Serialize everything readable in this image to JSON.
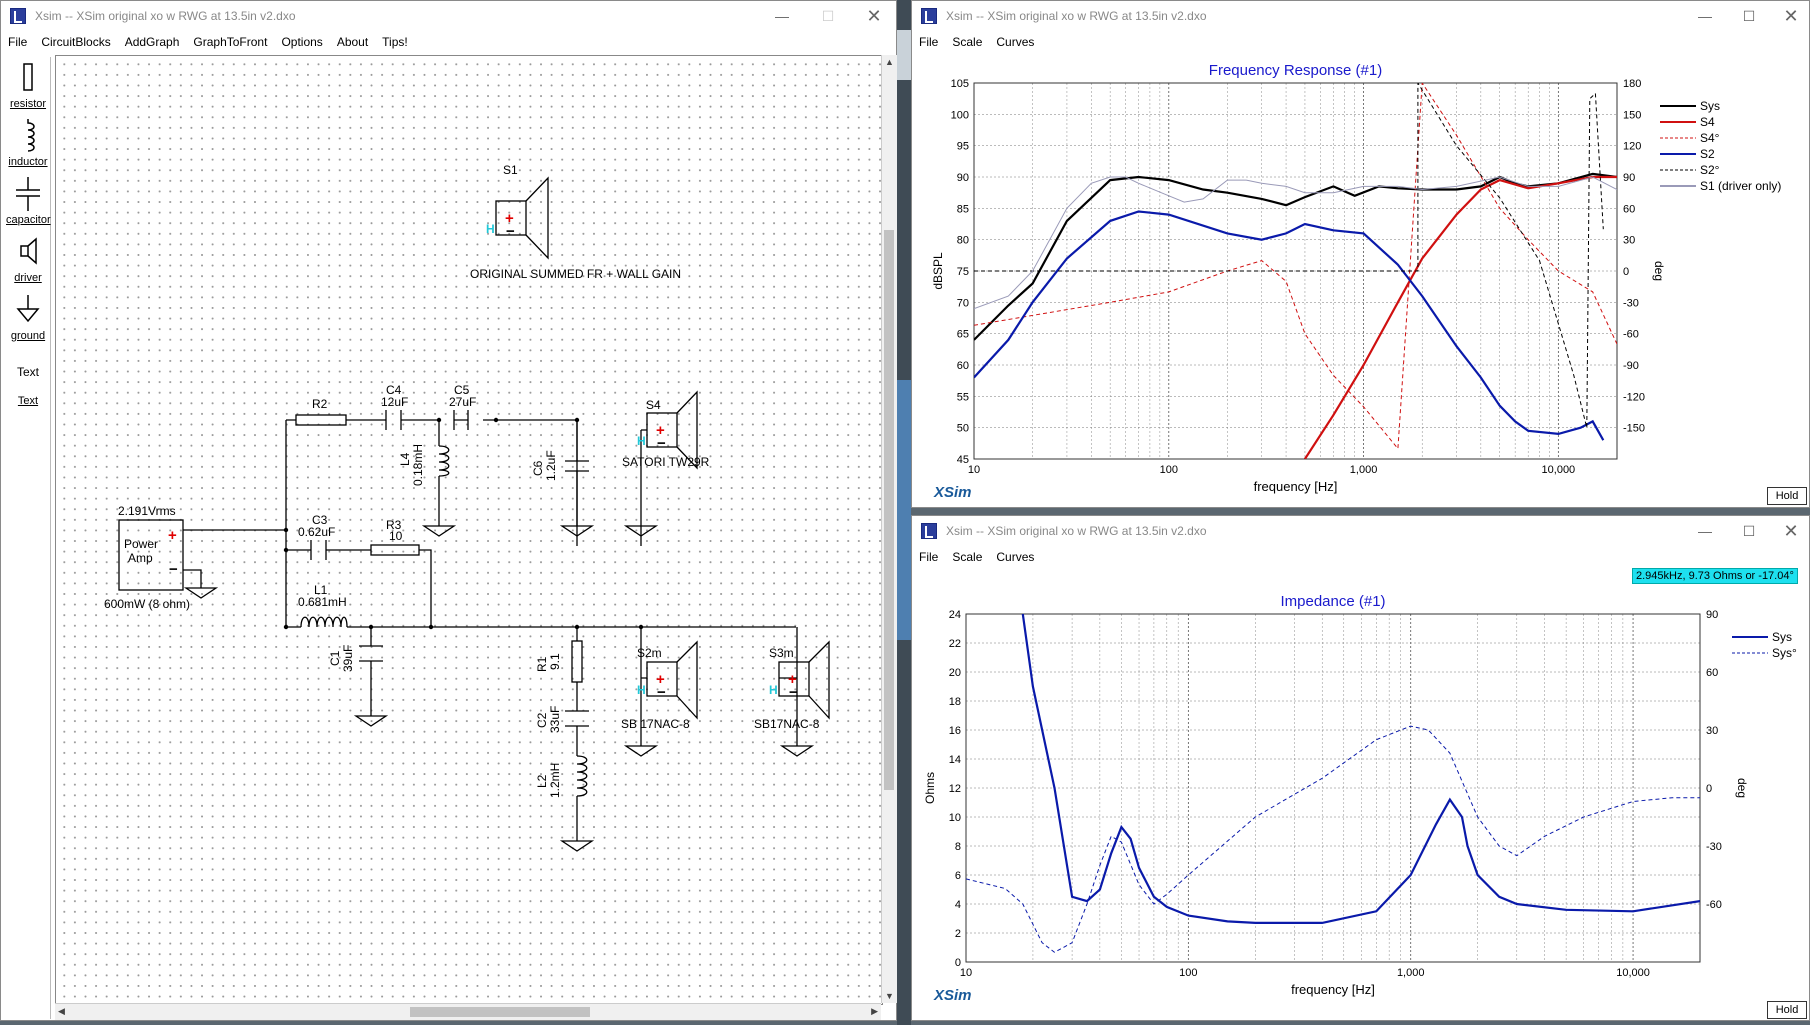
{
  "left_window": {
    "title": "Xsim -- XSim original xo w RWG at 13.5in v2.dxo",
    "menu": [
      "File",
      "CircuitBlocks",
      "AddGraph",
      "GraphToFront",
      "Options",
      "About",
      "Tips!"
    ],
    "toolbox": [
      "resistor",
      "inductor",
      "capacitor",
      "driver",
      "ground",
      "Text",
      "Text"
    ],
    "schematic": {
      "s1_label": "S1",
      "s1_desc": "ORIGINAL SUMMED FR + WALL GAIN",
      "r2": "R2",
      "c4": "C4",
      "c4_val": "12uF",
      "c5": "C5",
      "c5_val": "27uF",
      "l4": "L4",
      "l4_val": "0.18mH",
      "c6": "C6",
      "c6_val": "1.2uF",
      "s4": "S4",
      "s4_desc": "SATORI TW29R",
      "amp_v": "2.191Vrms",
      "amp_label1": "Power",
      "amp_label2": "Amp",
      "amp_power": "600mW (8 ohm)",
      "c3": "C3",
      "c3_val": "0.62uF",
      "r3": "R3",
      "r3_val": "10",
      "l1": "L1",
      "l1_val": "0.681mH",
      "c1": "C1",
      "c1_val": "39uF",
      "r1": "R1",
      "r1_val": "9.1",
      "c2": "C2",
      "c2_val": "33uF",
      "l2": "L2",
      "l2_val": "1.2mH",
      "s2m": "S2m",
      "s2m_desc": "SB 17NAC-8",
      "s3m": "S3m",
      "s3m_desc": "SB17NAC-8"
    }
  },
  "fr_window": {
    "title": "Xsim -- XSim original xo w RWG at 13.5in v2.dxo",
    "menu": [
      "File",
      "Scale",
      "Curves"
    ],
    "hold": "Hold",
    "brand": "XSim"
  },
  "imp_window": {
    "title": "Xsim -- XSim original xo w RWG at 13.5in v2.dxo",
    "menu": [
      "File",
      "Scale",
      "Curves"
    ],
    "hold": "Hold",
    "brand": "XSim",
    "readout": "2.945kHz, 9.73 Ohms or -17.04°"
  },
  "colors": {
    "sys": "#000000",
    "s4": "#d01010",
    "s2": "#0a1aaa",
    "s1": "#9a9ab8",
    "title": "#1a1acc",
    "brand": "#1a5a9a"
  },
  "chart_data": [
    {
      "type": "line",
      "title": "Frequency Response (#1)",
      "xlabel": "frequency [Hz]",
      "ylabel": "dBSPL",
      "y2label": "deg",
      "xscale": "log",
      "xlim": [
        10,
        20000
      ],
      "ylim": [
        45,
        105
      ],
      "y2lim": [
        -180,
        180
      ],
      "xticks": [
        "10",
        "100",
        "1,000",
        "10,000"
      ],
      "yticks": [
        45,
        50,
        55,
        60,
        65,
        70,
        75,
        80,
        85,
        90,
        95,
        100,
        105
      ],
      "y2ticks": [
        -150,
        -120,
        -90,
        -60,
        -30,
        0,
        30,
        60,
        90,
        120,
        150,
        180
      ],
      "legend_position": "top-right",
      "grid": true,
      "series": [
        {
          "name": "Sys",
          "axis": "left",
          "style": "solid",
          "color": "#000000",
          "x": [
            10,
            15,
            20,
            30,
            50,
            70,
            100,
            150,
            200,
            300,
            400,
            500,
            700,
            900,
            1200,
            1500,
            2000,
            3000,
            4000,
            5000,
            6000,
            7000,
            10000,
            15000,
            20000
          ],
          "y": [
            64,
            69.5,
            73,
            83,
            89.5,
            90,
            89.5,
            88,
            87.5,
            86.5,
            85.5,
            86.8,
            88.5,
            87,
            88.5,
            88.2,
            88,
            88,
            88.5,
            90,
            89,
            88.5,
            89,
            90.5,
            90
          ]
        },
        {
          "name": "S4",
          "axis": "left",
          "style": "solid",
          "color": "#d01010",
          "x": [
            500,
            700,
            1000,
            1500,
            2000,
            3000,
            4000,
            5000,
            7000,
            10000,
            15000,
            20000
          ],
          "y": [
            45,
            52,
            60,
            70,
            77,
            84,
            88,
            89.5,
            88.2,
            89,
            90,
            90
          ]
        },
        {
          "name": "S4°",
          "axis": "right",
          "style": "dashed",
          "color": "#d01010",
          "x": [
            10,
            50,
            100,
            200,
            300,
            400,
            500,
            700,
            1000,
            1500,
            2000,
            3000,
            5000,
            7000,
            10000,
            15000,
            20000
          ],
          "y": [
            -52,
            -30,
            -20,
            0,
            10,
            -10,
            -60,
            -100,
            -130,
            -170,
            180,
            130,
            60,
            30,
            0,
            -20,
            -70
          ]
        },
        {
          "name": "S2",
          "axis": "left",
          "style": "solid",
          "color": "#0a1aaa",
          "x": [
            10,
            15,
            20,
            30,
            50,
            70,
            100,
            200,
            300,
            400,
            500,
            700,
            1000,
            1500,
            2000,
            3000,
            4000,
            5000,
            6000,
            7000,
            10000,
            13000,
            15000,
            17000
          ],
          "y": [
            58,
            64,
            70,
            77,
            83,
            84.5,
            84,
            81,
            80,
            81,
            82.5,
            81.5,
            81,
            76,
            71,
            63,
            58,
            53.5,
            51,
            49.5,
            49,
            50,
            51,
            48
          ]
        },
        {
          "name": "S2°",
          "axis": "right",
          "style": "dashed",
          "color": "#000000",
          "x": [
            10,
            100,
            500,
            1000,
            1900,
            1900,
            3000,
            5000,
            8000,
            12000,
            14000,
            14500,
            15500,
            17000
          ],
          "y": [
            0,
            0,
            0,
            0,
            0,
            180,
            120,
            70,
            10,
            -100,
            -150,
            165,
            170,
            40
          ]
        },
        {
          "name": "S1 (driver only)",
          "axis": "left",
          "style": "solid",
          "color": "#9a9ab8",
          "x": [
            10,
            15,
            20,
            30,
            40,
            50,
            60,
            70,
            100,
            120,
            150,
            200,
            250,
            300,
            400,
            500,
            700,
            1000,
            1500,
            2000,
            3000,
            5000,
            7000,
            10000,
            15000,
            20000
          ],
          "y": [
            69,
            71,
            75,
            85,
            89,
            90,
            90,
            89,
            87,
            86,
            86.5,
            89.5,
            89.5,
            89,
            88.5,
            87.5,
            87.5,
            88.5,
            88.5,
            88,
            88.5,
            90,
            88.5,
            88.5,
            90,
            88
          ]
        }
      ]
    },
    {
      "type": "line",
      "title": "Impedance (#1)",
      "xlabel": "frequency [Hz]",
      "ylabel": "Ohms",
      "y2label": "deg",
      "xscale": "log",
      "xlim": [
        10,
        20000
      ],
      "ylim": [
        0,
        24
      ],
      "y2lim": [
        -90,
        90
      ],
      "xticks": [
        "10",
        "100",
        "1,000",
        "10,000"
      ],
      "yticks": [
        0,
        2,
        4,
        6,
        8,
        10,
        12,
        14,
        16,
        18,
        20,
        22,
        24
      ],
      "y2ticks": [
        -60,
        -30,
        0,
        30,
        60,
        90
      ],
      "legend_position": "top-right",
      "grid": true,
      "series": [
        {
          "name": "Sys",
          "axis": "left",
          "style": "solid",
          "color": "#0a1aaa",
          "x": [
            18,
            20,
            25,
            30,
            35,
            40,
            45,
            50,
            55,
            60,
            70,
            80,
            100,
            150,
            200,
            400,
            700,
            1000,
            1300,
            1500,
            1700,
            1800,
            2000,
            2500,
            3000,
            5000,
            10000,
            20000
          ],
          "y": [
            24,
            19,
            12,
            4.5,
            4.2,
            5,
            7.5,
            9.3,
            8.5,
            6.5,
            4.5,
            3.8,
            3.2,
            2.8,
            2.7,
            2.7,
            3.5,
            6,
            9.5,
            11.2,
            10,
            8,
            6,
            4.5,
            4,
            3.6,
            3.5,
            4.2
          ]
        },
        {
          "name": "Sys°",
          "axis": "right",
          "style": "dashed",
          "color": "#0a1aaa",
          "x": [
            10,
            15,
            18,
            22,
            25,
            30,
            35,
            40,
            45,
            50,
            60,
            70,
            80,
            100,
            200,
            400,
            700,
            1000,
            1200,
            1500,
            2000,
            2500,
            3000,
            4000,
            6000,
            10000,
            15000,
            20000
          ],
          "y": [
            -47,
            -52,
            -60,
            -80,
            -85,
            -80,
            -60,
            -40,
            -25,
            -28,
            -50,
            -60,
            -55,
            -45,
            -15,
            5,
            25,
            32,
            30,
            18,
            -15,
            -30,
            -35,
            -25,
            -15,
            -7,
            -5,
            -5
          ]
        }
      ]
    }
  ]
}
